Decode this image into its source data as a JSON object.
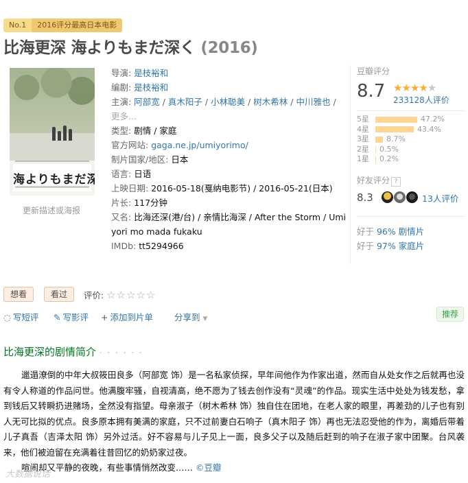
{
  "badge": {
    "no": "No.1",
    "text": "2016评分最高日本电影"
  },
  "title": {
    "main": "比海更深 海よりもまだ深く",
    "year": "(2016)"
  },
  "poster": {
    "title_text": "海よりもまだ深く",
    "link": "更新描述或海报"
  },
  "info": {
    "director_label": "导演:",
    "director": "是枝裕和",
    "writer_label": "编剧:",
    "writer": "是枝裕和",
    "cast_label": "主演:",
    "cast": [
      "阿部宽",
      "真木阳子",
      "小林聪美",
      "树木希林",
      "中川雅也"
    ],
    "cast_more": "更多...",
    "genre_label": "类型:",
    "genres": [
      "剧情",
      "家庭"
    ],
    "site_label": "官方网站:",
    "site": "gaga.ne.jp/umiyorimo/",
    "country_label": "制片国家/地区:",
    "country": "日本",
    "language_label": "语言:",
    "language": "日语",
    "release_label": "上映日期:",
    "release1": "2016-05-18(戛纳电影节)",
    "release_sep": " / ",
    "release2": "2016-05-21(日本)",
    "runtime_label": "片长:",
    "runtime": "117分钟",
    "aka_label": "又名:",
    "aka_line1": "比海还深(港/台) / 亲情比海深 / After the Storm / Umi",
    "aka_line2": "yori mo mada fukaku",
    "imdb_label": "IMDb:",
    "imdb": "tt5294966"
  },
  "rating": {
    "label": "豆瓣评分",
    "score": "8.7",
    "count": "233128人评价",
    "bars": [
      {
        "label": "5星",
        "percent": "47.2%",
        "value": 47.2
      },
      {
        "label": "4星",
        "percent": "43.4%",
        "value": 43.4
      },
      {
        "label": "3星",
        "percent": "8.7%",
        "value": 8.7
      },
      {
        "label": "2星",
        "percent": "0.5%",
        "value": 0.5
      },
      {
        "label": "1星",
        "percent": "0.2%",
        "value": 0.2
      }
    ],
    "friend_label": "好友评分",
    "friend_help": "?",
    "friend_score": "8.3",
    "friend_count": "13人评价",
    "better": [
      {
        "prefix": "好于 ",
        "pct": "96%",
        "cat": "剧情片"
      },
      {
        "prefix": "好于 ",
        "pct": "97%",
        "cat": "家庭片"
      }
    ]
  },
  "actions": {
    "want": "想看",
    "seen": "看过",
    "rate_label": "评价:",
    "short_review": "写短评",
    "review": "写影评",
    "add_list": "添加到片单",
    "share": "分享到",
    "recommend": "推荐"
  },
  "synopsis": {
    "heading": "比海更深的剧情简介",
    "dots": "· · · · · ·",
    "para1": "邋遢潦倒的中年大叔筱田良多（阿部宽 饰）是一名私家侦探，早年间他作为作家出道，然而自从处女作之后就再也没有令人称道的作品问世。他满腹牢骚，自视清高，绝不愿为了钱去创作没有“灵魂”的作品。现实生活中处处为钱发愁，拿到钱后又转瞬扔进赌场，全然没有指望。母亲淑子（树木希林 饰）独自住在团地，在老人家的眼里，再差劲的儿子也有别人无可比拟的优点。良多原本拥有美满的家庭，只不过前妻白石响子（真木阳子 饰）再也无法忍受他的作为，离婚后带着儿子真吾（吉泽太阳 饰）另外过活。好不容易与儿子见上一面，良多父子以及随后赶到的响子在淑子家中团聚。台风袭来，他们被迫留在充满着往昔回忆的奶奶家过夜。",
    "para2": "喧闹却又平静的夜晚，有些事情悄然改变……",
    "source": "©豆瓣"
  },
  "watermark": "大数据说话"
}
